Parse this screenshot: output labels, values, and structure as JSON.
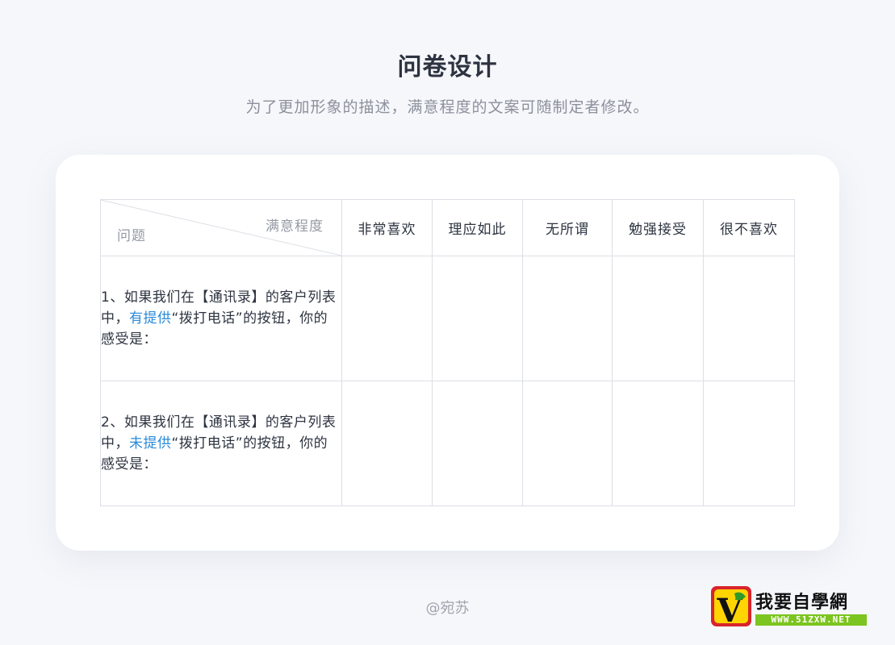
{
  "header": {
    "title": "问卷设计",
    "subtitle": "为了更加形象的描述，满意程度的文案可随制定者修改。"
  },
  "table": {
    "corner": {
      "rating_label": "满意程度",
      "question_label": "问题"
    },
    "columns": [
      "非常喜欢",
      "理应如此",
      "无所谓",
      "勉强接受",
      "很不喜欢"
    ],
    "rows": [
      {
        "before": "1、如果我们在【通讯录】的客户列表中，",
        "highlight": "有提供",
        "after": "“拨打电话”的按钮，你的感受是："
      },
      {
        "before": "2、如果我们在【通讯录】的客户列表中，",
        "highlight": "未提供",
        "after": "“拨打电话”的按钮，你的感受是："
      }
    ]
  },
  "footer": {
    "author": "@宛苏"
  },
  "watermark": {
    "logo_letter": "V",
    "name": "我要自學網",
    "url": "WWW.51ZXW.NET"
  },
  "colors": {
    "background": "#f6f7fb",
    "card": "#ffffff",
    "title": "#2d3340",
    "subtitle": "#8b909b",
    "highlight": "#2a8ad8",
    "grid_line": "#dcdfe6"
  }
}
